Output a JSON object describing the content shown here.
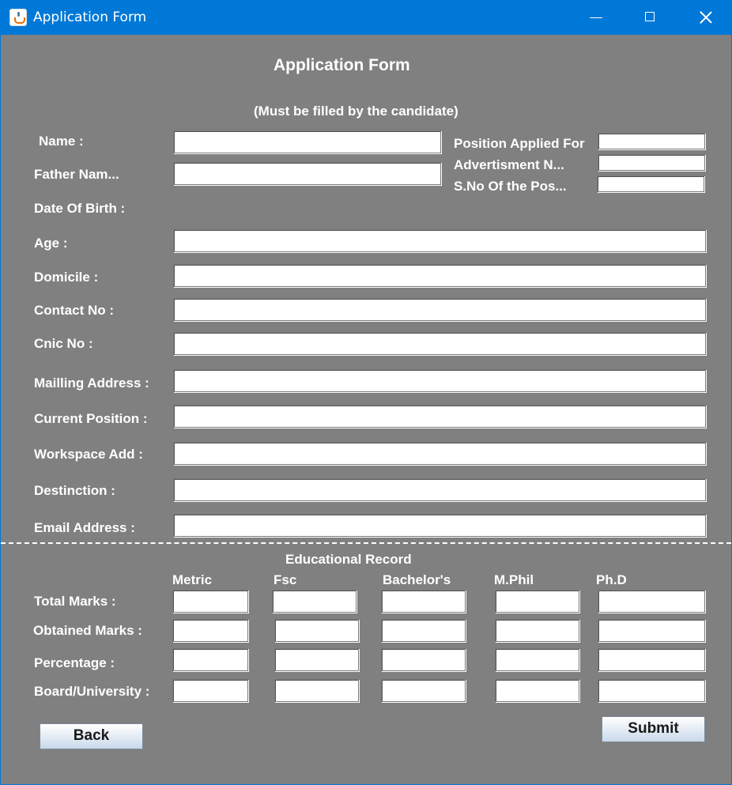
{
  "window": {
    "title": "Application Form"
  },
  "form": {
    "heading": "Application Form",
    "subheading": "(Must be filled by the candidate)",
    "labels": {
      "name": "Name :",
      "father_name": "Father Nam...",
      "dob": "Date Of Birth :",
      "age": "Age :",
      "domicile": "Domicile :",
      "contact": "Contact No :",
      "cnic": "Cnic No :",
      "mailing": "Mailling Address :",
      "current_position": "Current Position :",
      "workspace": "Workspace Add :",
      "distinction": "Destinction :",
      "email": "Email Address :",
      "position_applied": "Position Applied For",
      "advertisment": "Advertisment N...",
      "sno_post": "S.No Of the Pos..."
    },
    "values": {
      "name": "",
      "father_name": "",
      "age": "",
      "domicile": "",
      "contact": "",
      "cnic": "",
      "mailing": "",
      "current_position": "",
      "workspace": "",
      "distinction": "",
      "email": "",
      "position_applied": "",
      "advertisment": "",
      "sno_post": ""
    }
  },
  "education": {
    "title": "Educational Record",
    "columns": [
      "Metric",
      "Fsc",
      "Bachelor's",
      "M.Phil",
      "Ph.D"
    ],
    "rows": [
      "Total Marks :",
      "Obtained Marks :",
      "Percentage :",
      "Board/University :"
    ]
  },
  "buttons": {
    "back": "Back",
    "submit": "Submit"
  }
}
